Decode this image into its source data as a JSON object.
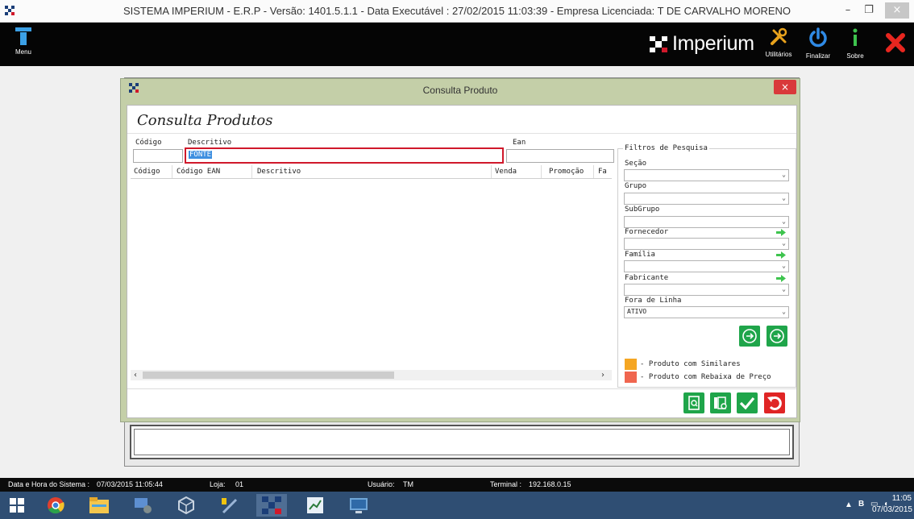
{
  "window": {
    "title": "SISTEMA IMPERIUM - E.R.P - Versão: 1401.5.1.1 - Data Executável : 27/02/2015 11:03:39 - Empresa Licenciada: T DE CARVALHO MORENO",
    "controls": {
      "minimize": "–",
      "maximize": "❐",
      "close": "×"
    }
  },
  "toolbar": {
    "menu_label": "Menu",
    "brand": "Imperium",
    "buttons": [
      {
        "label": "Utilitários",
        "icon": "tools-icon"
      },
      {
        "label": "Finalizar",
        "icon": "power-icon"
      },
      {
        "label": "Sobre",
        "icon": "info-icon"
      }
    ]
  },
  "dialog": {
    "title": "Consulta Produto",
    "close": "×",
    "heading": "Consulta Produtos",
    "fields": {
      "codigo_label": "Código",
      "codigo_value": "",
      "descritivo_label": "Descritivo",
      "descritivo_value": "FONTE",
      "ean_label": "Ean",
      "ean_value": ""
    },
    "grid": {
      "columns": [
        "Código",
        "Código EAN",
        "Descritivo",
        "Venda",
        "Promoção",
        "Fa"
      ],
      "rows": []
    },
    "filters": {
      "legend": "Filtros de Pesquisa",
      "items": [
        {
          "label": "Seção",
          "value": ""
        },
        {
          "label": "Grupo",
          "value": ""
        },
        {
          "label": "SubGrupo",
          "value": ""
        },
        {
          "label": "Fornecedor",
          "value": ""
        },
        {
          "label": "Família",
          "value": ""
        },
        {
          "label": "Fabricante",
          "value": ""
        },
        {
          "label": "Fora de Linha",
          "value": "ATIVO"
        }
      ],
      "legend_items": [
        {
          "text": "- Produto com Similares",
          "color": "#f5a623"
        },
        {
          "text": "- Produto com Rebaixa de Preço",
          "color": "#f0664f"
        }
      ]
    },
    "actions": [
      "search-doc-icon",
      "list-search-icon",
      "confirm-check-icon",
      "undo-icon"
    ]
  },
  "status": {
    "datetime_label": "Data e Hora do Sistema :",
    "datetime_value": "07/03/2015 11:05:44",
    "loja_label": "Loja:",
    "loja_value": "01",
    "usuario_label": "Usuário:",
    "usuario_value": "TM",
    "terminal_label": "Terminal :",
    "terminal_value": "192.168.0.15"
  },
  "taskbar": {
    "apps": [
      "windows-start-icon",
      "chrome-icon",
      "file-explorer-icon",
      "network-app-icon",
      "virtualbox-icon",
      "tools-app-icon",
      "imperium-app-icon",
      "chart-app-icon",
      "remote-desktop-icon"
    ],
    "tray_flag": "B",
    "clock_time": "11:05",
    "clock_date": "07/03/2015"
  },
  "colors": {
    "accent_green": "#1fa54a",
    "error_red": "#d0192b",
    "toolbar_bg": "#050505"
  }
}
